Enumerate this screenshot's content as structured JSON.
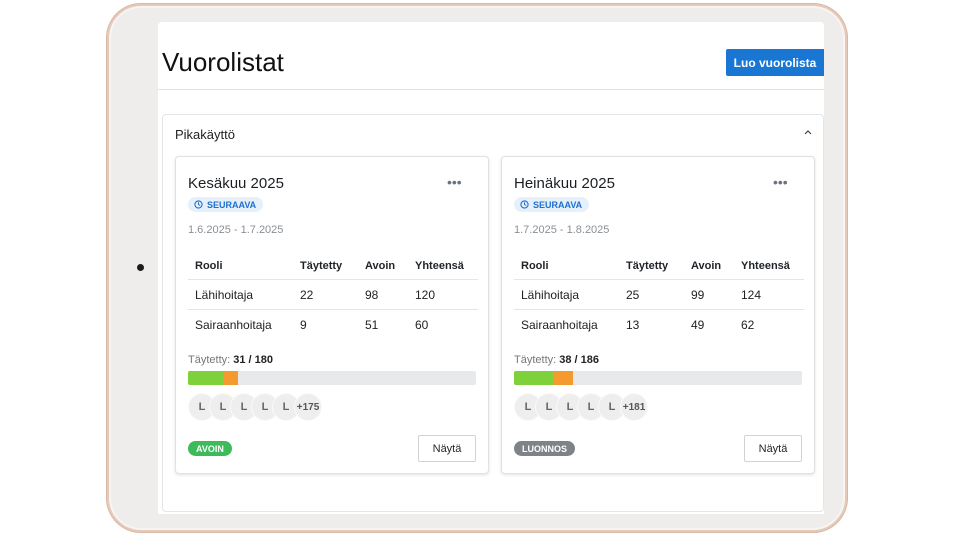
{
  "header": {
    "title": "Vuorolistat",
    "create_button": "Luo vuorolista"
  },
  "quick_access": {
    "title": "Pikakäyttö",
    "collapse_icon": "chevron-up-icon",
    "cards": [
      {
        "title": "Kesäkuu 2025",
        "badge": "SEURAAVA",
        "dates": "1.6.2025 - 1.7.2025",
        "columns": [
          "Rooli",
          "Täytetty",
          "Avoin",
          "Yhteensä"
        ],
        "rows": [
          [
            "Lähihoitaja",
            "22",
            "98",
            "120"
          ],
          [
            "Sairaanhoitaja",
            "9",
            "51",
            "60"
          ]
        ],
        "filled_label": "Täytetty:",
        "filled_value": "31 / 180",
        "progress": {
          "green": 0.122,
          "orange": 0.05
        },
        "avatars": [
          "L",
          "L",
          "L",
          "L",
          "L"
        ],
        "avatars_more": "+175",
        "status": "AVOIN",
        "show_button": "Näytä"
      },
      {
        "title": "Heinäkuu 2025",
        "badge": "SEURAAVA",
        "dates": "1.7.2025 - 1.8.2025",
        "columns": [
          "Rooli",
          "Täytetty",
          "Avoin",
          "Yhteensä"
        ],
        "rows": [
          [
            "Lähihoitaja",
            "25",
            "99",
            "124"
          ],
          [
            "Sairaanhoitaja",
            "13",
            "49",
            "62"
          ]
        ],
        "filled_label": "Täytetty:",
        "filled_value": "38 / 186",
        "progress": {
          "green": 0.134,
          "orange": 0.07
        },
        "avatars": [
          "L",
          "L",
          "L",
          "L",
          "L"
        ],
        "avatars_more": "+181",
        "status": "LUONNOS",
        "show_button": "Näytä"
      }
    ]
  },
  "colors": {
    "primary": "#1976d2",
    "open": "#3dbb5a",
    "draft": "#7d8389",
    "progress_green": "#7ed13b",
    "progress_orange": "#f59a2e"
  }
}
